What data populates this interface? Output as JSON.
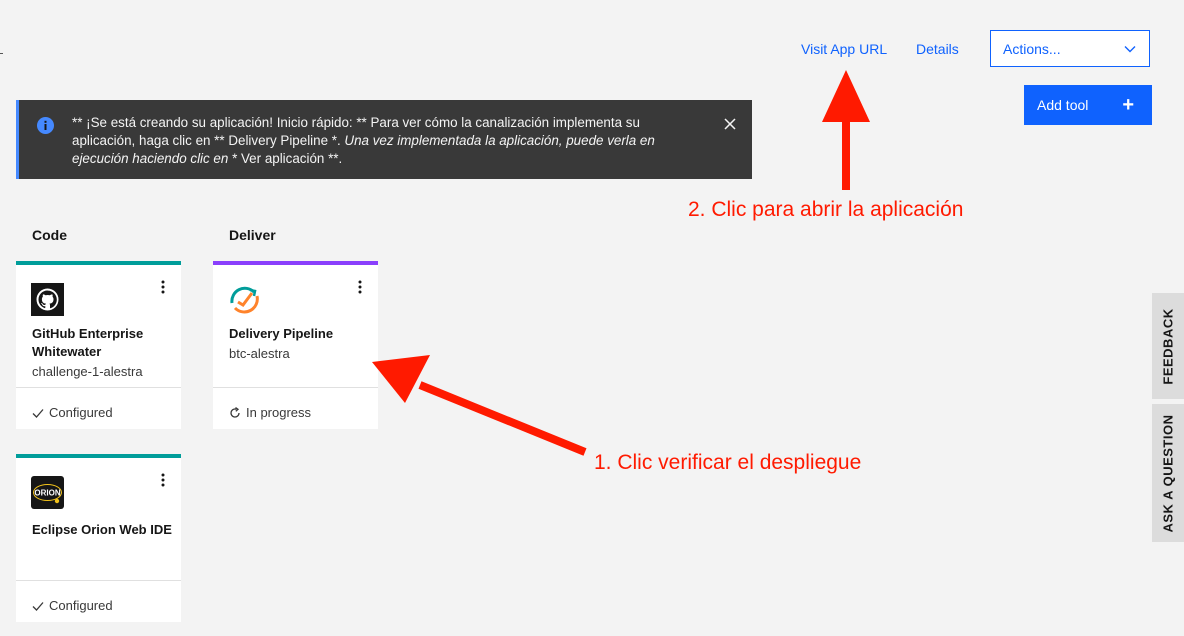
{
  "header": {
    "visit_app_url": "Visit App URL",
    "details": "Details",
    "actions_placeholder": "Actions...",
    "add_tool": "Add tool"
  },
  "notification": {
    "message_normal": "** ¡Se está creando su aplicación! Inicio rápido: ** Para ver cómo la canalización implementa su aplicación, haga clic en ** Delivery Pipeline *.",
    "message_italic": " Una vez implementada la aplicación, puede verla en ejecución haciendo clic en ",
    "message_tail": "* Ver aplicación **."
  },
  "columns": {
    "code": "Code",
    "deliver": "Deliver"
  },
  "cards": {
    "github": {
      "name": "GitHub Enterprise Whitewater",
      "sub": "challenge-1-alestra",
      "status": "Configured"
    },
    "pipeline": {
      "name": "Delivery Pipeline",
      "sub": "btc-alestra",
      "status": "In progress"
    },
    "orion": {
      "name": "Eclipse Orion Web IDE",
      "logo_text": "ORION",
      "status": "Configured"
    }
  },
  "side_tabs": {
    "feedback": "FEEDBACK",
    "ask": "ASK A QUESTION"
  },
  "annotations": {
    "step2": "2. Clic para abrir la aplicación",
    "step1": "1. Clic verificar el despliegue"
  },
  "colors": {
    "primary": "#0f62fe",
    "teal": "#009d9a",
    "purple": "#8a3ffc",
    "annotation": "#ff1a00"
  }
}
